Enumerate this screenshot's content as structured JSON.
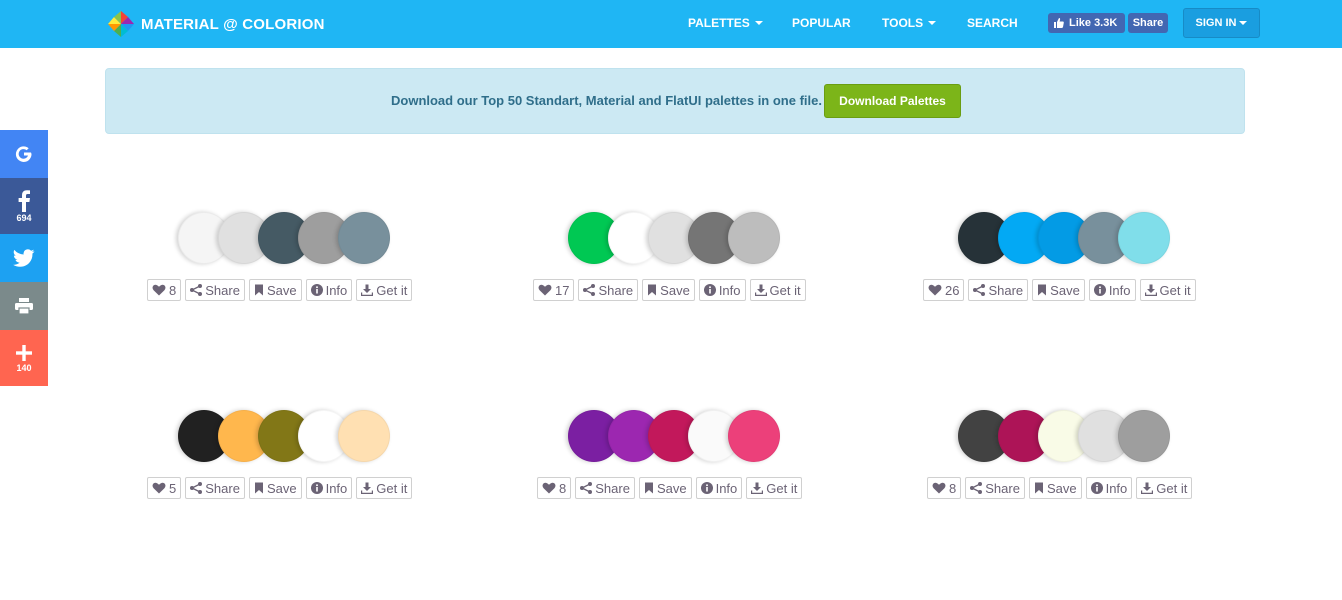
{
  "brand": {
    "name": "MATERIAL @ COLORION"
  },
  "nav": {
    "palettes": "PALETTES",
    "popular": "POPULAR",
    "tools": "TOOLS",
    "search": "SEARCH",
    "fb_like": "Like 3.3K",
    "fb_share": "Share",
    "signin": "SIGN IN"
  },
  "banner": {
    "text": "Download our Top 50 Standart, Material and FlatUI palettes in one file.",
    "button": "Download Palettes"
  },
  "social": {
    "facebook_count": "694",
    "more_count": "140",
    "colors": {
      "google": "#4285f4",
      "facebook": "#3b5998",
      "twitter": "#1da1f2",
      "print": "#7b8a8b",
      "more": "#ff6550"
    }
  },
  "actions": {
    "share": "Share",
    "save": "Save",
    "info": "Info",
    "get": "Get it"
  },
  "palettes": [
    {
      "likes": "8",
      "colors": [
        "#f5f5f5",
        "#e0e0e0",
        "#455a64",
        "#9e9e9e",
        "#78909c"
      ]
    },
    {
      "likes": "17",
      "colors": [
        "#00c853",
        "#ffffff",
        "#e0e0e0",
        "#757575",
        "#bdbdbd"
      ]
    },
    {
      "likes": "26",
      "colors": [
        "#263238",
        "#03a9f4",
        "#039be5",
        "#78909c",
        "#80deea"
      ]
    },
    {
      "likes": "5",
      "colors": [
        "#212121",
        "#ffb74d",
        "#827717",
        "#ffffff",
        "#ffe0b2"
      ]
    },
    {
      "likes": "8",
      "colors": [
        "#7b1fa2",
        "#9c27b0",
        "#c2185b",
        "#fafafa",
        "#ec407a"
      ]
    },
    {
      "likes": "8",
      "colors": [
        "#424242",
        "#ad1457",
        "#f9fbe7",
        "#e0e0e0",
        "#9e9e9e"
      ]
    }
  ]
}
